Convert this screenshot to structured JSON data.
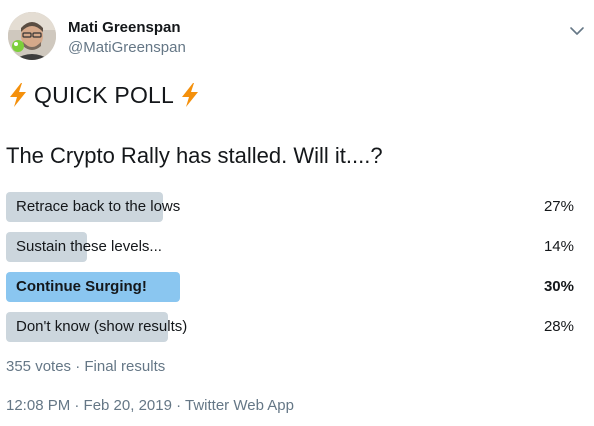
{
  "author": {
    "name": "Mati Greenspan",
    "handle": "@MatiGreenspan",
    "avatar": "avatar-photo"
  },
  "tweet": {
    "title": "QUICK POLL",
    "question": "The Crypto Rally has stalled. Will it....?"
  },
  "poll": {
    "choices": [
      {
        "label": "Retrace back to the lows",
        "percent": "27%",
        "share": 0.27,
        "winner": false
      },
      {
        "label": "Sustain these levels...",
        "percent": "14%",
        "share": 0.14,
        "winner": false
      },
      {
        "label": "Continue Surging!",
        "percent": "30%",
        "share": 0.3,
        "winner": true
      },
      {
        "label": "Don't know (show results)",
        "percent": "28%",
        "share": 0.28,
        "winner": false
      }
    ],
    "summary": "355 votes · Final results"
  },
  "footer": {
    "timestamp": "12:08 PM · Feb 20, 2019 · Twitter Web App"
  },
  "colors": {
    "bar": "#ccd6dd",
    "winner_bar": "#8ac6f0",
    "secondary_text": "#657786",
    "bolt": "#f4900c"
  },
  "icons": {
    "menu": "chevron-down-icon",
    "emoji": "lightning-bolt-icon"
  }
}
